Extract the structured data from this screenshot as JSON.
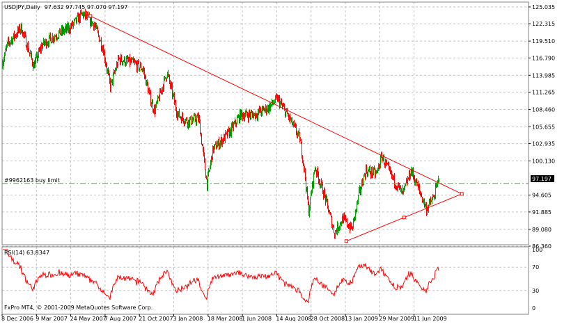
{
  "header": {
    "symbol": "USDJPY,Daily",
    "ohlc": "97.632 97.745 97.070 97.197"
  },
  "indicator": {
    "label": "RSI(14) 63.8347"
  },
  "copyright": "FxPro MT4, © 2001-2009 MetaQuotes Software Corp.",
  "order_line": {
    "label": "#9962163 buy limit",
    "price": 96.5,
    "color": "#3cb043"
  },
  "current_price": "97.197",
  "colors": {
    "bull": "#00a000",
    "bear": "#ff0000",
    "triangle": "#ff0000",
    "rsi": "#ff0000",
    "grid": "#c0c0c0"
  },
  "chart_data": {
    "type": "candlestick",
    "title": "USDJPY,Daily",
    "ylim": [
      86.36,
      125.035
    ],
    "y_ticks": [
      "125.035",
      "122.315",
      "119.510",
      "116.790",
      "113.985",
      "111.265",
      "108.460",
      "105.655",
      "102.935",
      "100.130",
      "94.605",
      "91.885",
      "89.080",
      "86.360"
    ],
    "x_ticks": [
      "8 Dec 2006",
      "9 Mar 2007",
      "24 May 2007",
      "7 Aug 2007",
      "21 Oct 2007",
      "3 Jan 2008",
      "18 Mar 2008",
      "1 Jun 2008",
      "14 Aug 2008",
      "28 Oct 2008",
      "13 Jan 2009",
      "29 Mar 2009",
      "11 Jun 2009"
    ],
    "x_tick_dates": [
      "2006-12-08",
      "2007-03-09",
      "2007-05-24",
      "2007-08-07",
      "2007-10-21",
      "2008-01-03",
      "2008-03-18",
      "2008-06-01",
      "2008-08-14",
      "2008-10-28",
      "2009-01-13",
      "2009-03-29",
      "2009-06-11"
    ],
    "close_path": [
      [
        "2006-12-08",
        116
      ],
      [
        "2006-12-21",
        118.9
      ],
      [
        "2007-01-27",
        121.7
      ],
      [
        "2007-03-01",
        115.5
      ],
      [
        "2007-03-21",
        118.9
      ],
      [
        "2007-04-21",
        120.5
      ],
      [
        "2007-05-22",
        121.7
      ],
      [
        "2007-06-18",
        123.9
      ],
      [
        "2007-07-14",
        122.2
      ],
      [
        "2007-08-02",
        118.3
      ],
      [
        "2007-08-18",
        112.1
      ],
      [
        "2007-09-05",
        116.6
      ],
      [
        "2007-10-05",
        116
      ],
      [
        "2007-10-28",
        115
      ],
      [
        "2007-11-12",
        110.4
      ],
      [
        "2007-11-22",
        108.2
      ],
      [
        "2007-12-19",
        114.4
      ],
      [
        "2008-01-11",
        107.6
      ],
      [
        "2008-02-03",
        106.5
      ],
      [
        "2008-02-26",
        107
      ],
      [
        "2008-03-15",
        96.4
      ],
      [
        "2008-03-28",
        102
      ],
      [
        "2008-05-04",
        104.8
      ],
      [
        "2008-05-27",
        107.6
      ],
      [
        "2008-06-26",
        107.6
      ],
      [
        "2008-07-26",
        108.7
      ],
      [
        "2008-08-15",
        110.2
      ],
      [
        "2008-09-10",
        107
      ],
      [
        "2008-10-03",
        103.7
      ],
      [
        "2008-10-13",
        98.6
      ],
      [
        "2008-10-22",
        91.9
      ],
      [
        "2008-11-05",
        99.2
      ],
      [
        "2008-11-26",
        94.7
      ],
      [
        "2008-12-19",
        88.5
      ],
      [
        "2009-01-06",
        90.8
      ],
      [
        "2009-01-27",
        89.1
      ],
      [
        "2009-02-11",
        94.7
      ],
      [
        "2009-02-26",
        98.6
      ],
      [
        "2009-03-21",
        98
      ],
      [
        "2009-04-02",
        100.9
      ],
      [
        "2009-04-20",
        98
      ],
      [
        "2009-05-17",
        94.7
      ],
      [
        "2009-06-04",
        98.6
      ],
      [
        "2009-06-19",
        95.8
      ],
      [
        "2009-07-07",
        92.4
      ],
      [
        "2009-07-22",
        94.1
      ],
      [
        "2009-08-03",
        97.197
      ]
    ],
    "triangle": [
      [
        "2007-07-06",
        123.57
      ],
      [
        "2009-09-22",
        94.81
      ],
      [
        "2009-01-15",
        87.17
      ]
    ],
    "rsi": {
      "period": 14,
      "ylim": [
        0,
        100
      ],
      "y_ticks": [
        "100",
        "70",
        "30",
        "0"
      ],
      "last": 63.8347
    }
  }
}
